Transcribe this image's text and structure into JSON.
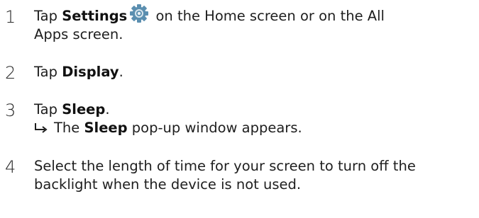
{
  "steps": [
    {
      "number": "1",
      "line1_pre": "Tap ",
      "line1_bold": "Settings",
      "settings_icon": "gear-icon",
      "line1_post": " on the Home screen or on the All",
      "line2": "Apps screen."
    },
    {
      "number": "2",
      "pre": "Tap ",
      "bold": "Display",
      "post": "."
    },
    {
      "number": "3",
      "pre": "Tap ",
      "bold": "Sleep",
      "post": ".",
      "result_icon": "result-arrow-icon",
      "result_pre": "The ",
      "result_bold": "Sleep",
      "result_post": " pop-up window appears."
    },
    {
      "number": "4",
      "line1": "Select the length of time for your screen to turn off the",
      "line2": "backlight when the device is not used."
    }
  ],
  "colors": {
    "text": "#1e1e1e",
    "gear_icon": "#5b8fb0"
  }
}
